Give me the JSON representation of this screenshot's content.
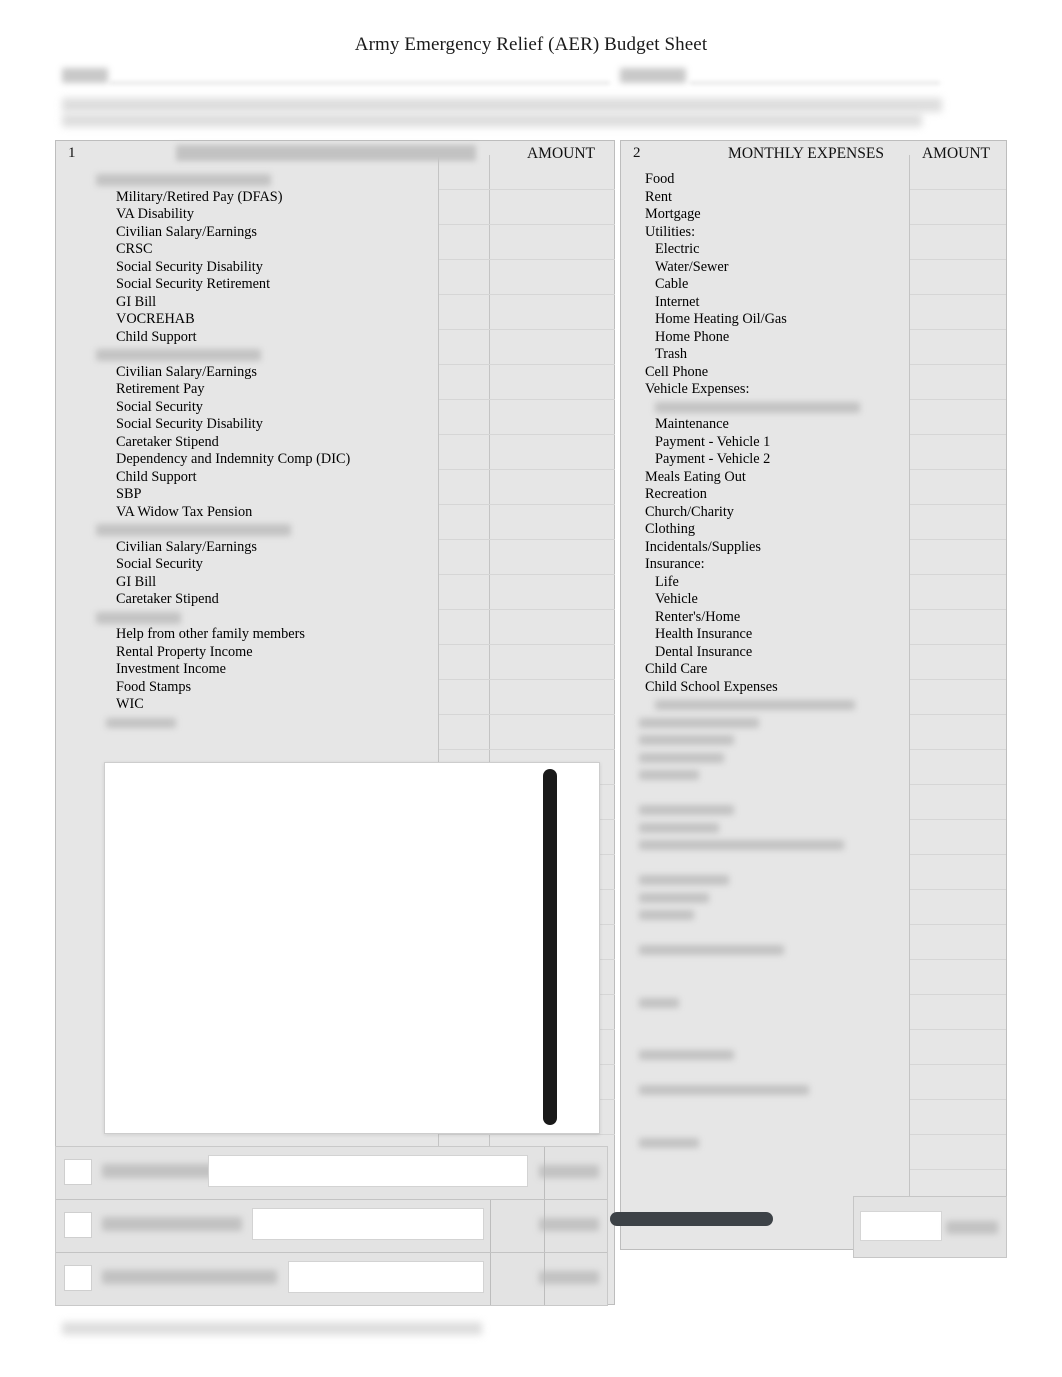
{
  "document": {
    "title": "Army Emergency Relief (AER) Budget Sheet"
  },
  "header": {
    "field_label_left": "",
    "field_label_right": "",
    "instruction_line_1": "",
    "instruction_line_2": ""
  },
  "income_column": {
    "number": "1",
    "title": "",
    "amount_header": "AMOUNT",
    "groups": [
      {
        "heading": "",
        "items": [
          "Military/Retired Pay (DFAS)",
          "VA Disability",
          "Civilian Salary/Earnings",
          "CRSC",
          "Social Security Disability",
          "Social Security Retirement",
          "GI Bill",
          "VOCREHAB",
          "Child Support"
        ]
      },
      {
        "heading": "",
        "items": [
          "Civilian Salary/Earnings",
          "Retirement Pay",
          "Social Security",
          "Social Security Disability",
          "Caretaker Stipend",
          "Dependency and Indemnity Comp (DIC)",
          "Child Support",
          "SBP",
          "VA Widow Tax Pension"
        ]
      },
      {
        "heading": "",
        "items": [
          "Civilian Salary/Earnings",
          "Social Security",
          "GI Bill",
          "Caretaker Stipend"
        ]
      },
      {
        "heading": "",
        "items": [
          "Help from other family members",
          "Rental Property Income",
          "Investment Income",
          "Food Stamps",
          "WIC"
        ]
      }
    ]
  },
  "expense_column": {
    "number": "2",
    "title": "MONTHLY EXPENSES",
    "amount_header": "AMOUNT",
    "items": [
      {
        "label": "Food",
        "indent": 0
      },
      {
        "label": "Rent",
        "indent": 0
      },
      {
        "label": "Mortgage",
        "indent": 0
      },
      {
        "label": "Utilities:",
        "indent": 0
      },
      {
        "label": "Electric",
        "indent": 1
      },
      {
        "label": "Water/Sewer",
        "indent": 1
      },
      {
        "label": "Cable",
        "indent": 1
      },
      {
        "label": "Internet",
        "indent": 1
      },
      {
        "label": "Home Heating Oil/Gas",
        "indent": 1
      },
      {
        "label": "Home Phone",
        "indent": 1
      },
      {
        "label": "Trash",
        "indent": 1
      },
      {
        "label": "Cell Phone",
        "indent": 0
      },
      {
        "label": "Vehicle Expenses:",
        "indent": 0
      },
      {
        "label": "",
        "indent": 1
      },
      {
        "label": "Maintenance",
        "indent": 1
      },
      {
        "label": "Payment - Vehicle 1",
        "indent": 1
      },
      {
        "label": "Payment - Vehicle 2",
        "indent": 1
      },
      {
        "label": "Meals Eating Out",
        "indent": 0
      },
      {
        "label": "Recreation",
        "indent": 0
      },
      {
        "label": "Church/Charity",
        "indent": 0
      },
      {
        "label": "Clothing",
        "indent": 0
      },
      {
        "label": "Incidentals/Supplies",
        "indent": 0
      },
      {
        "label": "Insurance:",
        "indent": 0
      },
      {
        "label": "Life",
        "indent": 1
      },
      {
        "label": "Vehicle",
        "indent": 1
      },
      {
        "label": "Renter's/Home",
        "indent": 1
      },
      {
        "label": "Health Insurance",
        "indent": 1
      },
      {
        "label": "Dental Insurance",
        "indent": 1
      },
      {
        "label": "Child Care",
        "indent": 0
      },
      {
        "label": "Child School Expenses",
        "indent": 0
      }
    ],
    "redacted_rows_count": 26
  },
  "totals_left": {
    "rows": [
      {
        "label": "",
        "value": ""
      },
      {
        "label": "",
        "value": ""
      },
      {
        "label": "",
        "value": ""
      }
    ]
  },
  "totals_right": {
    "label": "",
    "value": ""
  },
  "footer": {
    "text": ""
  },
  "colors": {
    "page_background": "#ffffff",
    "sheet_background": "#e6e6e6",
    "grid_line": "#c4c4c4",
    "border": "#bdbdbd",
    "text": "#000000",
    "scrollbar": "#191919",
    "hscrollbar": "#3d4247"
  }
}
